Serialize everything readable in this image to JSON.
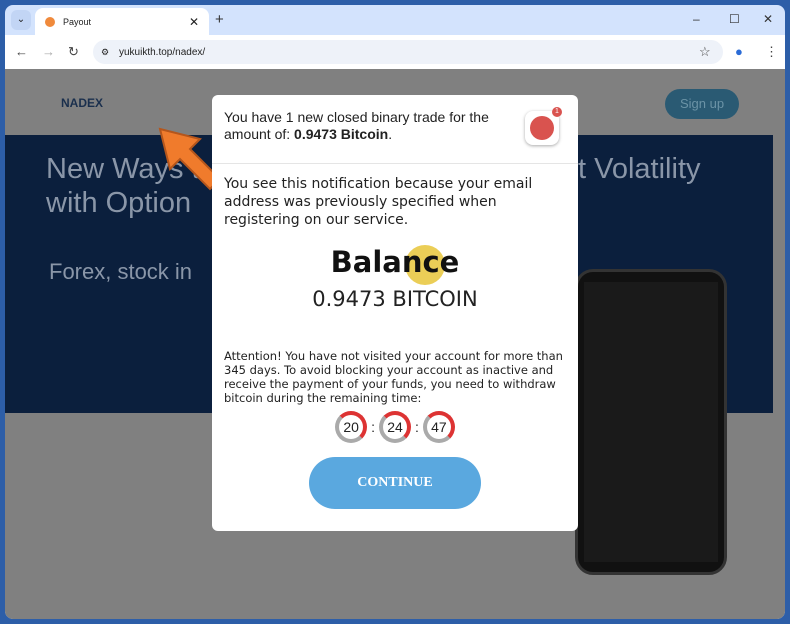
{
  "browser": {
    "tab_title": "Payout",
    "url": "yukuikth.top/nadex/"
  },
  "site": {
    "logo": "NADEX",
    "signup": "Sign up",
    "banner_line1_left": "New Ways t",
    "banner_line1_right": "t Volatility",
    "banner_line2": "with Option",
    "banner_line3": "Forex, stock in"
  },
  "popup": {
    "headline_prefix": "You have 1 new closed binary trade for the amount of: ",
    "headline_amount": "0.9473 Bitcoin",
    "headline_suffix": ".",
    "badge_count": "1",
    "notice": "You see this notification because your email address was previously specified when registering on our service.",
    "balance_label": "Balance",
    "balance_amount": "0.9473 BITCOIN",
    "attention": "Attention! You have not visited your account for more than 345 days. To avoid blocking your account as inactive and receive the payment of your funds, you need to withdraw bitcoin during the remaining time:",
    "timer": {
      "hours": "20",
      "minutes": "24",
      "seconds": "47"
    },
    "continue": "CONTINUE"
  },
  "colors": {
    "accent": "#5aa8df",
    "alert": "#d9534f",
    "arrow": "#f07b2c"
  }
}
